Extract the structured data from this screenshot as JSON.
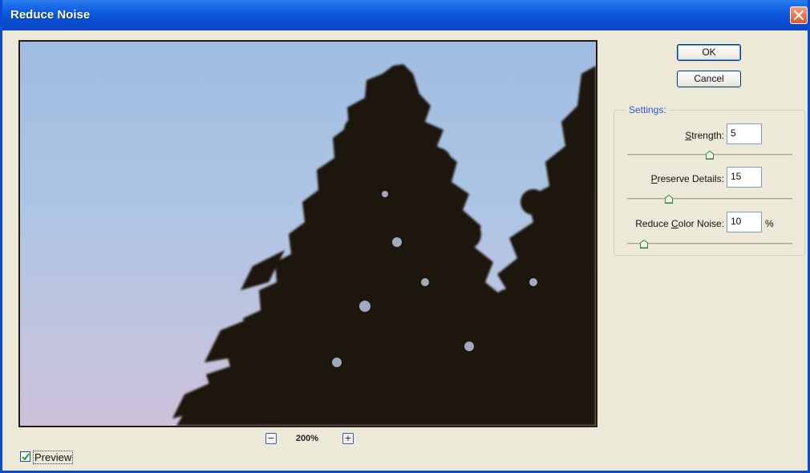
{
  "window": {
    "title": "Reduce Noise",
    "colors": {
      "titlebar": "#0a4cd0",
      "close": "#e2542b",
      "dialog_bg": "#ece9d8",
      "accent": "#2a5bd0"
    }
  },
  "buttons": {
    "ok": "OK",
    "cancel": "Cancel"
  },
  "zoom": {
    "minus": "−",
    "plus": "+",
    "level": "200%"
  },
  "preview": {
    "label": "Preview",
    "checked": true
  },
  "settings": {
    "legend": "Settings:",
    "strength": {
      "label_pre": "",
      "label_u": "S",
      "label_post": "trength:",
      "value": "5",
      "slider_fraction": 0.5
    },
    "preserve_details": {
      "label_pre": "",
      "label_u": "P",
      "label_post": "reserve Details:",
      "value": "15",
      "slider_fraction": 0.25
    },
    "reduce_color_noise": {
      "label_pre": "Reduce ",
      "label_u": "C",
      "label_post": "olor Noise:",
      "value": "10",
      "unit": "%",
      "slider_fraction": 0.1
    }
  },
  "icons": {
    "close": "close-icon",
    "check": "check-icon",
    "zoom_out": "zoom-out-icon",
    "zoom_in": "zoom-in-icon",
    "slider": "slider-thumb-icon"
  }
}
